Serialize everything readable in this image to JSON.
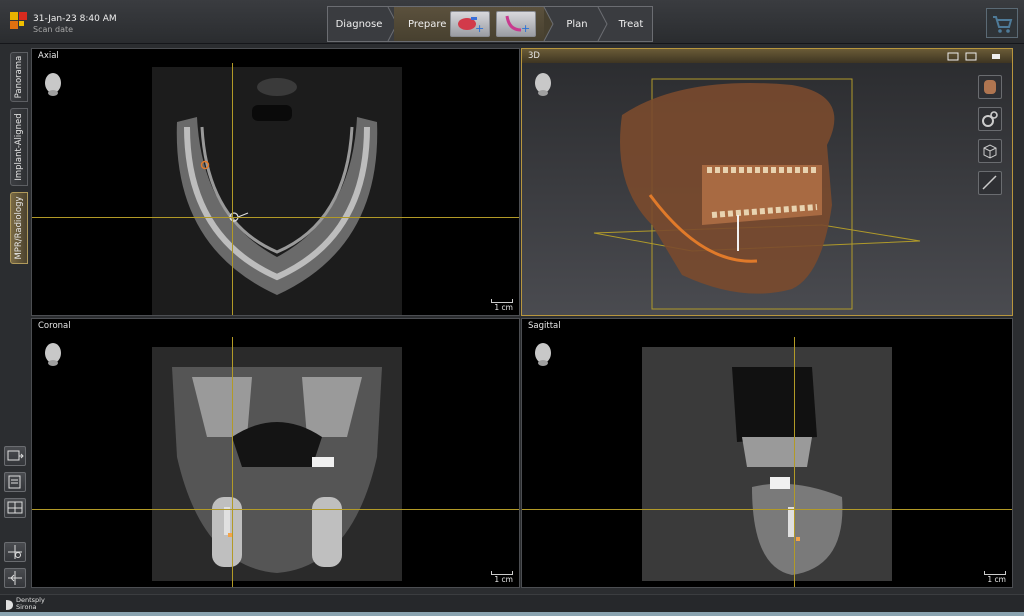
{
  "header": {
    "scan_date": "31-Jan-23 8:40 AM",
    "scan_label": "Scan date"
  },
  "workflow": {
    "steps": [
      "Diagnose",
      "Prepare",
      "Plan",
      "Treat"
    ],
    "active": "Prepare"
  },
  "sidebar": {
    "tabs": [
      {
        "label": "Panorama",
        "active": false
      },
      {
        "label": "Implant-Aligned",
        "active": false
      },
      {
        "label": "MPR/Radiology",
        "active": true
      }
    ]
  },
  "viewports": {
    "axial": {
      "title": "Axial",
      "scale": "1 cm"
    },
    "threed": {
      "title": "3D"
    },
    "coronal": {
      "title": "Coronal",
      "scale": "1 cm"
    },
    "sagittal": {
      "title": "Sagittal",
      "scale": "1 cm"
    }
  },
  "footer": {
    "brand_line1": "Dentsply",
    "brand_line2": "Sirona"
  },
  "colors": {
    "accent": "#b8963e",
    "crosshair": "#b29a27",
    "nerve": "#e07a2a"
  }
}
